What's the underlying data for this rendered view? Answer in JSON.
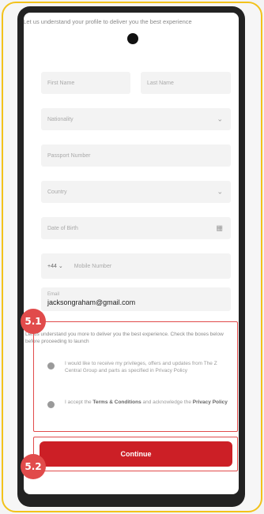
{
  "intro_text": "Let us understand your profile to deliver you the best experience",
  "form": {
    "first_name_placeholder": "First Name",
    "last_name_placeholder": "Last Name",
    "nationality_placeholder": "Nationality",
    "passport_placeholder": "Passport Number",
    "country_placeholder": "Country",
    "dob_placeholder": "Date of Birth",
    "country_code": "+44",
    "mobile_placeholder": "Mobile Number",
    "email_label": "Email",
    "email_value": "jacksongraham@gmail.com"
  },
  "consent": {
    "intro": "Let us understand you more to deliver you the best experience. Check the boxes below before proceeding to launch",
    "marketing_text": "I would like to receive my privileges, offers and updates from The Z Central Group and parts as specified in Privacy Policy",
    "terms_prefix": "I accept the",
    "terms_link": "Terms & Conditions",
    "terms_middle": "and acknowledge the",
    "privacy_link": "Privacy Policy"
  },
  "continue_label": "Continue",
  "annotations": {
    "badge_consent": "5.1",
    "badge_continue": "5.2"
  },
  "colors": {
    "frame": "#f2c21b",
    "primary": "#cc1f26",
    "annotation": "#e14b4b"
  }
}
